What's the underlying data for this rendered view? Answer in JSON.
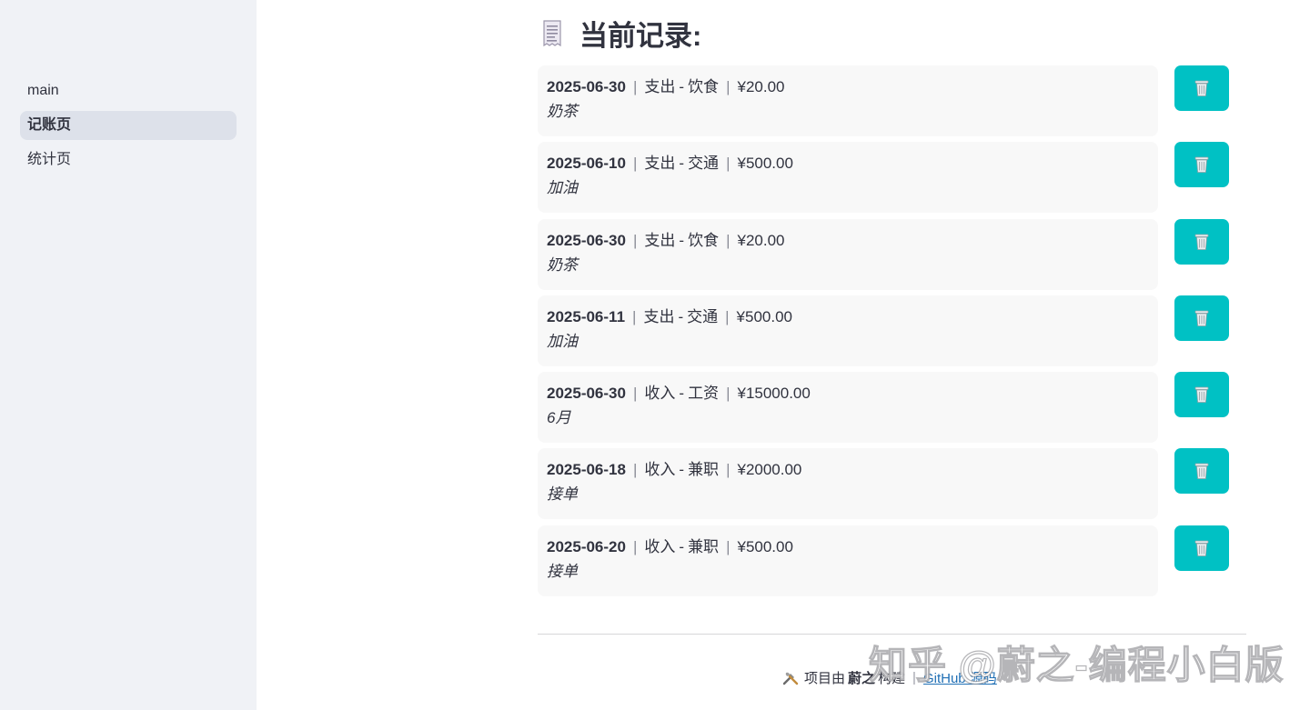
{
  "sidebar": {
    "items": [
      {
        "label": "main",
        "active": false
      },
      {
        "label": "记账页",
        "active": true
      },
      {
        "label": "统计页",
        "active": false
      }
    ]
  },
  "header": {
    "icon": "receipt-icon",
    "title": "当前记录:"
  },
  "records": [
    {
      "date": "2025-06-30",
      "type": "支出",
      "category": "饮食",
      "amount": "¥20.00",
      "note": "奶茶"
    },
    {
      "date": "2025-06-10",
      "type": "支出",
      "category": "交通",
      "amount": "¥500.00",
      "note": "加油"
    },
    {
      "date": "2025-06-30",
      "type": "支出",
      "category": "饮食",
      "amount": "¥20.00",
      "note": "奶茶"
    },
    {
      "date": "2025-06-11",
      "type": "支出",
      "category": "交通",
      "amount": "¥500.00",
      "note": "加油"
    },
    {
      "date": "2025-06-30",
      "type": "收入",
      "category": "工资",
      "amount": "¥15000.00",
      "note": "6月"
    },
    {
      "date": "2025-06-18",
      "type": "收入",
      "category": "兼职",
      "amount": "¥2000.00",
      "note": "接单"
    },
    {
      "date": "2025-06-20",
      "type": "收入",
      "category": "兼职",
      "amount": "¥500.00",
      "note": "接单"
    }
  ],
  "separator": "|",
  "dash": "-",
  "delete_button": {
    "icon": "trash-icon",
    "color": "#00c1c4"
  },
  "footer": {
    "icon": "tools-icon",
    "prefix": "项目由",
    "author": "蔚之",
    "suffix": "构建",
    "separator": "|",
    "link_text": "GitHub 源码"
  },
  "watermark": "知乎 @蔚之-编程小白版"
}
